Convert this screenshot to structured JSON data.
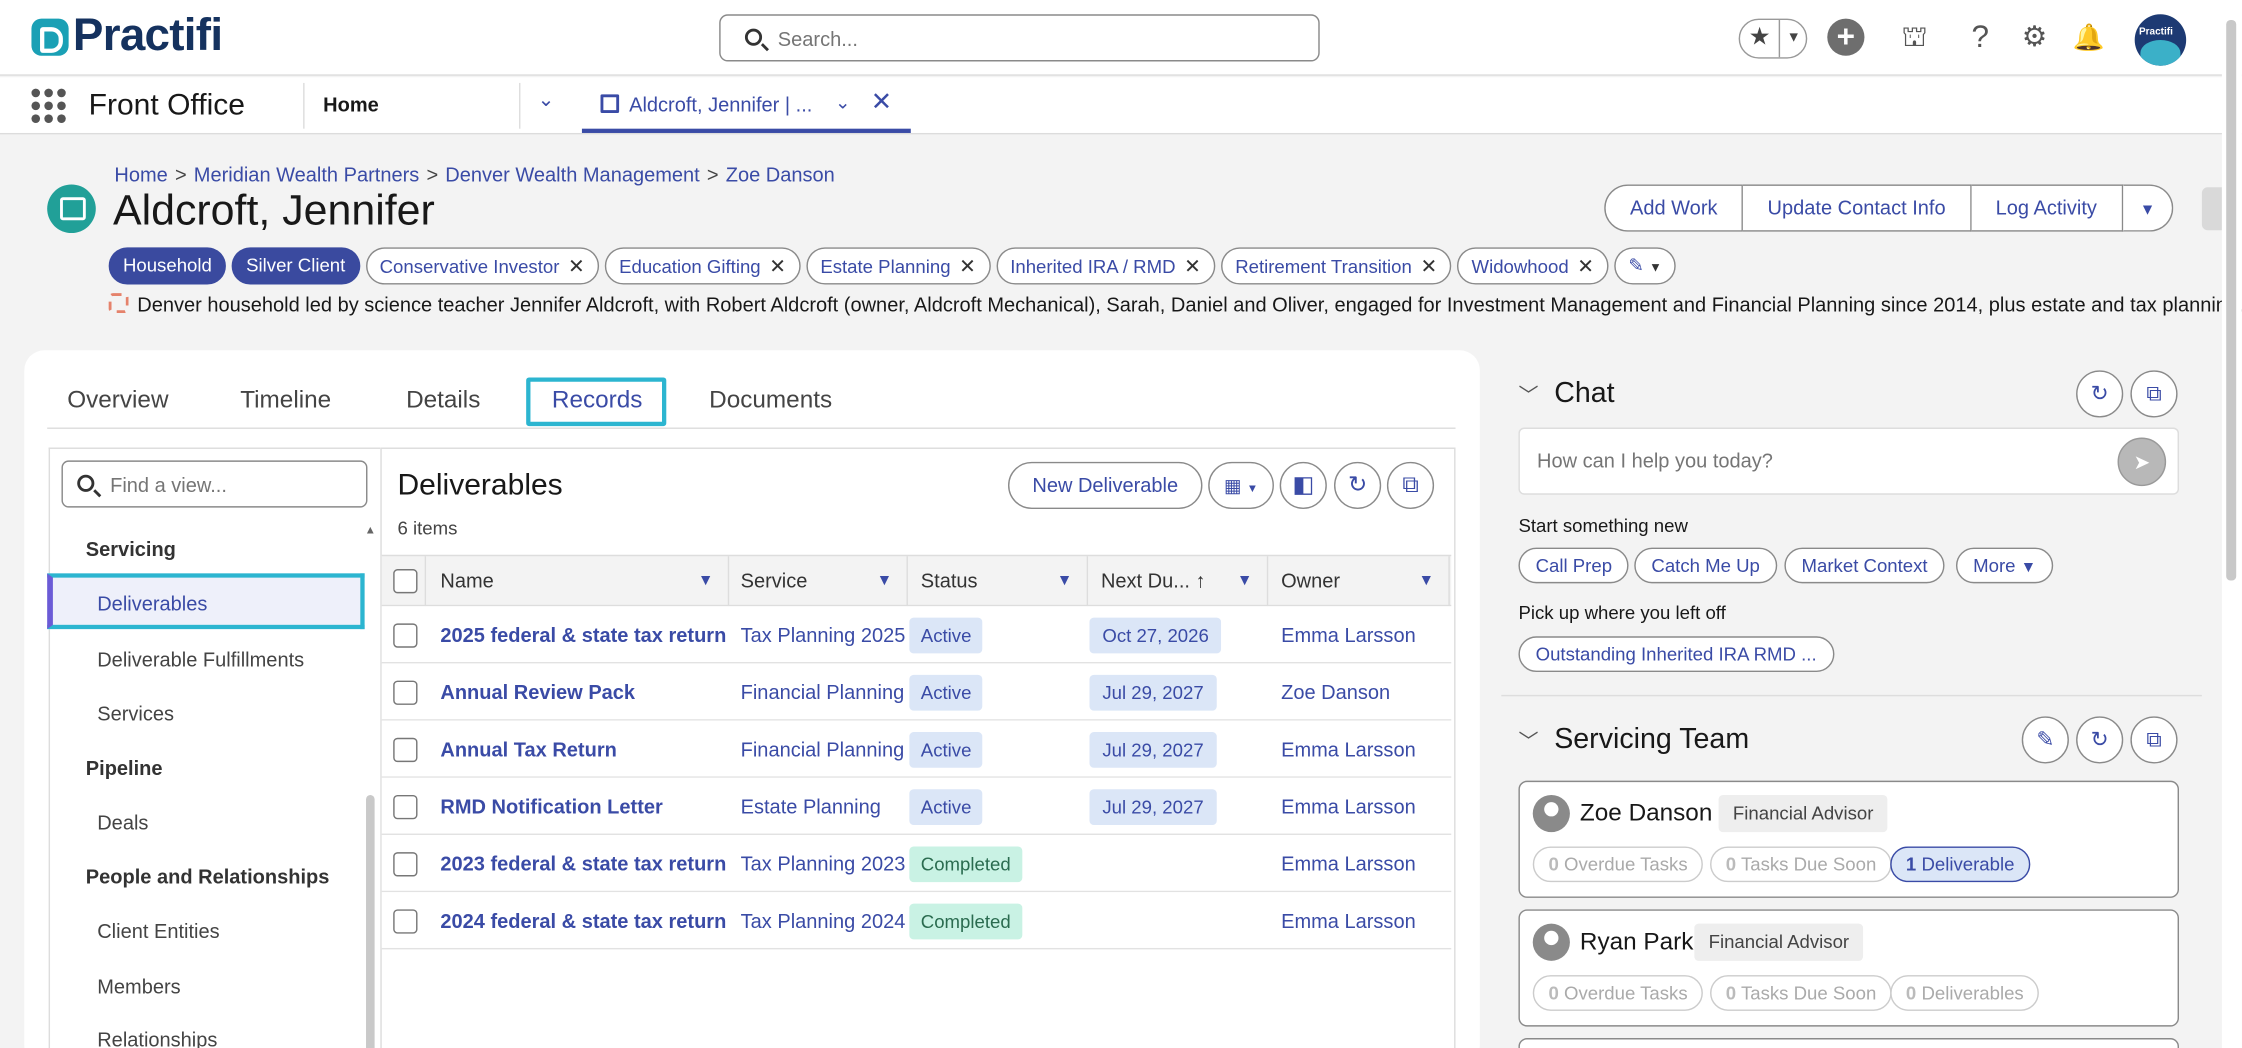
{
  "header": {
    "logo_text": "Practifi",
    "search_placeholder": "Search...",
    "avatar_text": "Practifi"
  },
  "nav": {
    "app_name": "Front Office",
    "home_tab": "Home",
    "record_tab": "Aldcroft, Jennifer | ..."
  },
  "record": {
    "breadcrumb": [
      "Home",
      "Meridian Wealth Partners",
      "Denver Wealth Management",
      "Zoe Danson"
    ],
    "title": "Aldcroft, Jennifer",
    "actions": [
      "Add Work",
      "Update Contact Info",
      "Log Activity"
    ],
    "badges": [
      "Household",
      "Silver Client"
    ],
    "tags": [
      "Conservative Investor",
      "Education Gifting",
      "Estate Planning",
      "Inherited IRA / RMD",
      "Retirement Transition",
      "Widowhood"
    ],
    "description": "Denver household led by science teacher Jennifer Aldcroft, with Robert Aldcroft (owner, Aldcroft Mechanical), Sarah, Daniel and Oliver, engaged for Investment Management and Financial Planning since 2014, plus estate and tax planning."
  },
  "tabs": [
    "Overview",
    "Timeline",
    "Details",
    "Records",
    "Documents"
  ],
  "active_tab": "Records",
  "sidebar": {
    "search_placeholder": "Find a view...",
    "groups": [
      {
        "title": "Servicing",
        "items": [
          "Deliverables",
          "Deliverable Fulfillments",
          "Services"
        ]
      },
      {
        "title": "Pipeline",
        "items": [
          "Deals"
        ]
      },
      {
        "title": "People and Relationships",
        "items": [
          "Client Entities",
          "Members",
          "Relationships"
        ]
      }
    ],
    "selected": "Deliverables"
  },
  "list": {
    "title": "Deliverables",
    "count": "6 items",
    "new_button": "New Deliverable",
    "columns": [
      "Name",
      "Service",
      "Status",
      "Next Du...",
      "Owner"
    ],
    "rows": [
      {
        "name": "2025 federal & state tax return",
        "service": "Tax Planning 2025",
        "status": "Active",
        "due": "Oct 27, 2026",
        "owner": "Emma Larsson"
      },
      {
        "name": "Annual Review Pack",
        "service": "Financial Planning",
        "status": "Active",
        "due": "Jul 29, 2027",
        "owner": "Zoe Danson"
      },
      {
        "name": "Annual Tax Return",
        "service": "Financial Planning",
        "status": "Active",
        "due": "Jul 29, 2027",
        "owner": "Emma Larsson"
      },
      {
        "name": "RMD Notification Letter",
        "service": "Estate Planning",
        "status": "Active",
        "due": "Jul 29, 2027",
        "owner": "Emma Larsson"
      },
      {
        "name": "2023 federal & state tax return",
        "service": "Tax Planning 2023",
        "status": "Completed",
        "due": "",
        "owner": "Emma Larsson"
      },
      {
        "name": "2024 federal & state tax return",
        "service": "Tax Planning 2024",
        "status": "Completed",
        "due": "",
        "owner": "Emma Larsson"
      }
    ]
  },
  "chat": {
    "title": "Chat",
    "placeholder": "How can I help you today?",
    "start_label": "Start something new",
    "start_pills": [
      "Call Prep",
      "Catch Me Up",
      "Market Context",
      "More"
    ],
    "resume_label": "Pick up where you left off",
    "resume_pill": "Outstanding Inherited IRA RMD ..."
  },
  "team": {
    "title": "Servicing Team",
    "members": [
      {
        "name": "Zoe Danson",
        "role": "Financial Advisor",
        "overdue": "0",
        "overdue_label": "Overdue Tasks",
        "soon": "0",
        "soon_label": "Tasks Due Soon",
        "deliverables": "1",
        "deliverables_label": "Deliverable"
      },
      {
        "name": "Ryan Park",
        "role": "Financial Advisor",
        "overdue": "0",
        "overdue_label": "Overdue Tasks",
        "soon": "0",
        "soon_label": "Tasks Due Soon",
        "deliverables": "0",
        "deliverables_label": "Deliverables"
      }
    ]
  },
  "colors": {
    "accent": "#3a4ba6",
    "focus": "#2cb5d0",
    "record_icon": "#21a098"
  }
}
